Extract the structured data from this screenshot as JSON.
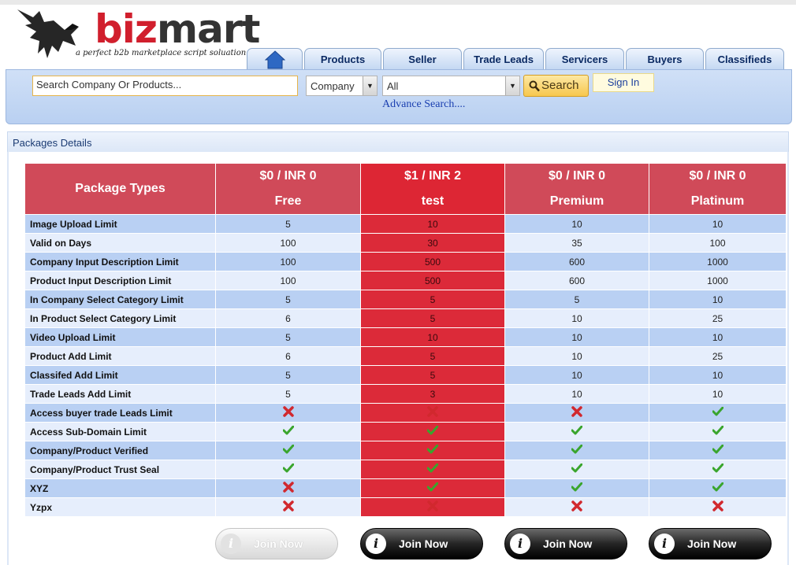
{
  "brand": {
    "name_part1": "biz",
    "name_part2": "mart",
    "tagline": "a perfect b2b marketplace script soluation",
    "colors": {
      "red": "#d11f2d",
      "dark": "#333333"
    }
  },
  "nav": {
    "home_icon": "home-icon",
    "tabs": [
      "Products",
      "Seller",
      "Trade Leads",
      "Servicers",
      "Buyers",
      "Classifieds"
    ]
  },
  "search": {
    "placeholder": "Search Company Or Products...",
    "type_value": "Company",
    "category_value": "All",
    "search_label": "Search",
    "signin_label": "Sign In",
    "advance_label": "Advance Search...."
  },
  "packages": {
    "title": "Packages Details",
    "header_label": "Package Types",
    "plans": [
      {
        "price": "$0 / INR 0",
        "name": "Free",
        "highlight": false,
        "join_label": "Join Now",
        "join_enabled": false
      },
      {
        "price": "$1 / INR 2",
        "name": "test",
        "highlight": true,
        "join_label": "Join Now",
        "join_enabled": true
      },
      {
        "price": "$0 / INR 0",
        "name": "Premium",
        "highlight": false,
        "join_label": "Join Now",
        "join_enabled": true
      },
      {
        "price": "$0 / INR 0",
        "name": "Platinum",
        "highlight": false,
        "join_label": "Join Now",
        "join_enabled": true
      }
    ],
    "rows": [
      {
        "label": "Image Upload Limit",
        "values": [
          "5",
          "10",
          "10",
          "10"
        ]
      },
      {
        "label": "Valid on Days",
        "values": [
          "100",
          "30",
          "35",
          "100"
        ]
      },
      {
        "label": "Company Input Description Limit",
        "values": [
          "100",
          "500",
          "600",
          "1000"
        ]
      },
      {
        "label": "Product Input Description Limit",
        "values": [
          "100",
          "500",
          "600",
          "1000"
        ]
      },
      {
        "label": "In Company Select Category Limit",
        "values": [
          "5",
          "5",
          "5",
          "10"
        ]
      },
      {
        "label": "In Product Select Category Limit",
        "values": [
          "6",
          "5",
          "10",
          "25"
        ]
      },
      {
        "label": "Video Upload Limit",
        "values": [
          "5",
          "10",
          "10",
          "10"
        ]
      },
      {
        "label": "Product Add Limit",
        "values": [
          "6",
          "5",
          "10",
          "25"
        ]
      },
      {
        "label": "Classifed Add Limit",
        "values": [
          "5",
          "5",
          "10",
          "10"
        ]
      },
      {
        "label": "Trade Leads Add Limit",
        "values": [
          "5",
          "3",
          "10",
          "10"
        ]
      },
      {
        "label": "Access buyer trade Leads Limit",
        "values": [
          "no",
          "no",
          "no",
          "yes"
        ]
      },
      {
        "label": "Access Sub-Domain Limit",
        "values": [
          "yes",
          "yes",
          "yes",
          "yes"
        ]
      },
      {
        "label": "Company/Product Verified",
        "values": [
          "yes",
          "yes",
          "yes",
          "yes"
        ]
      },
      {
        "label": "Company/Product Trust Seal",
        "values": [
          "yes",
          "yes",
          "yes",
          "yes"
        ]
      },
      {
        "label": "XYZ",
        "values": [
          "no",
          "yes",
          "yes",
          "yes"
        ]
      },
      {
        "label": "Yzpx",
        "values": [
          "no",
          "no",
          "no",
          "no"
        ]
      }
    ]
  }
}
